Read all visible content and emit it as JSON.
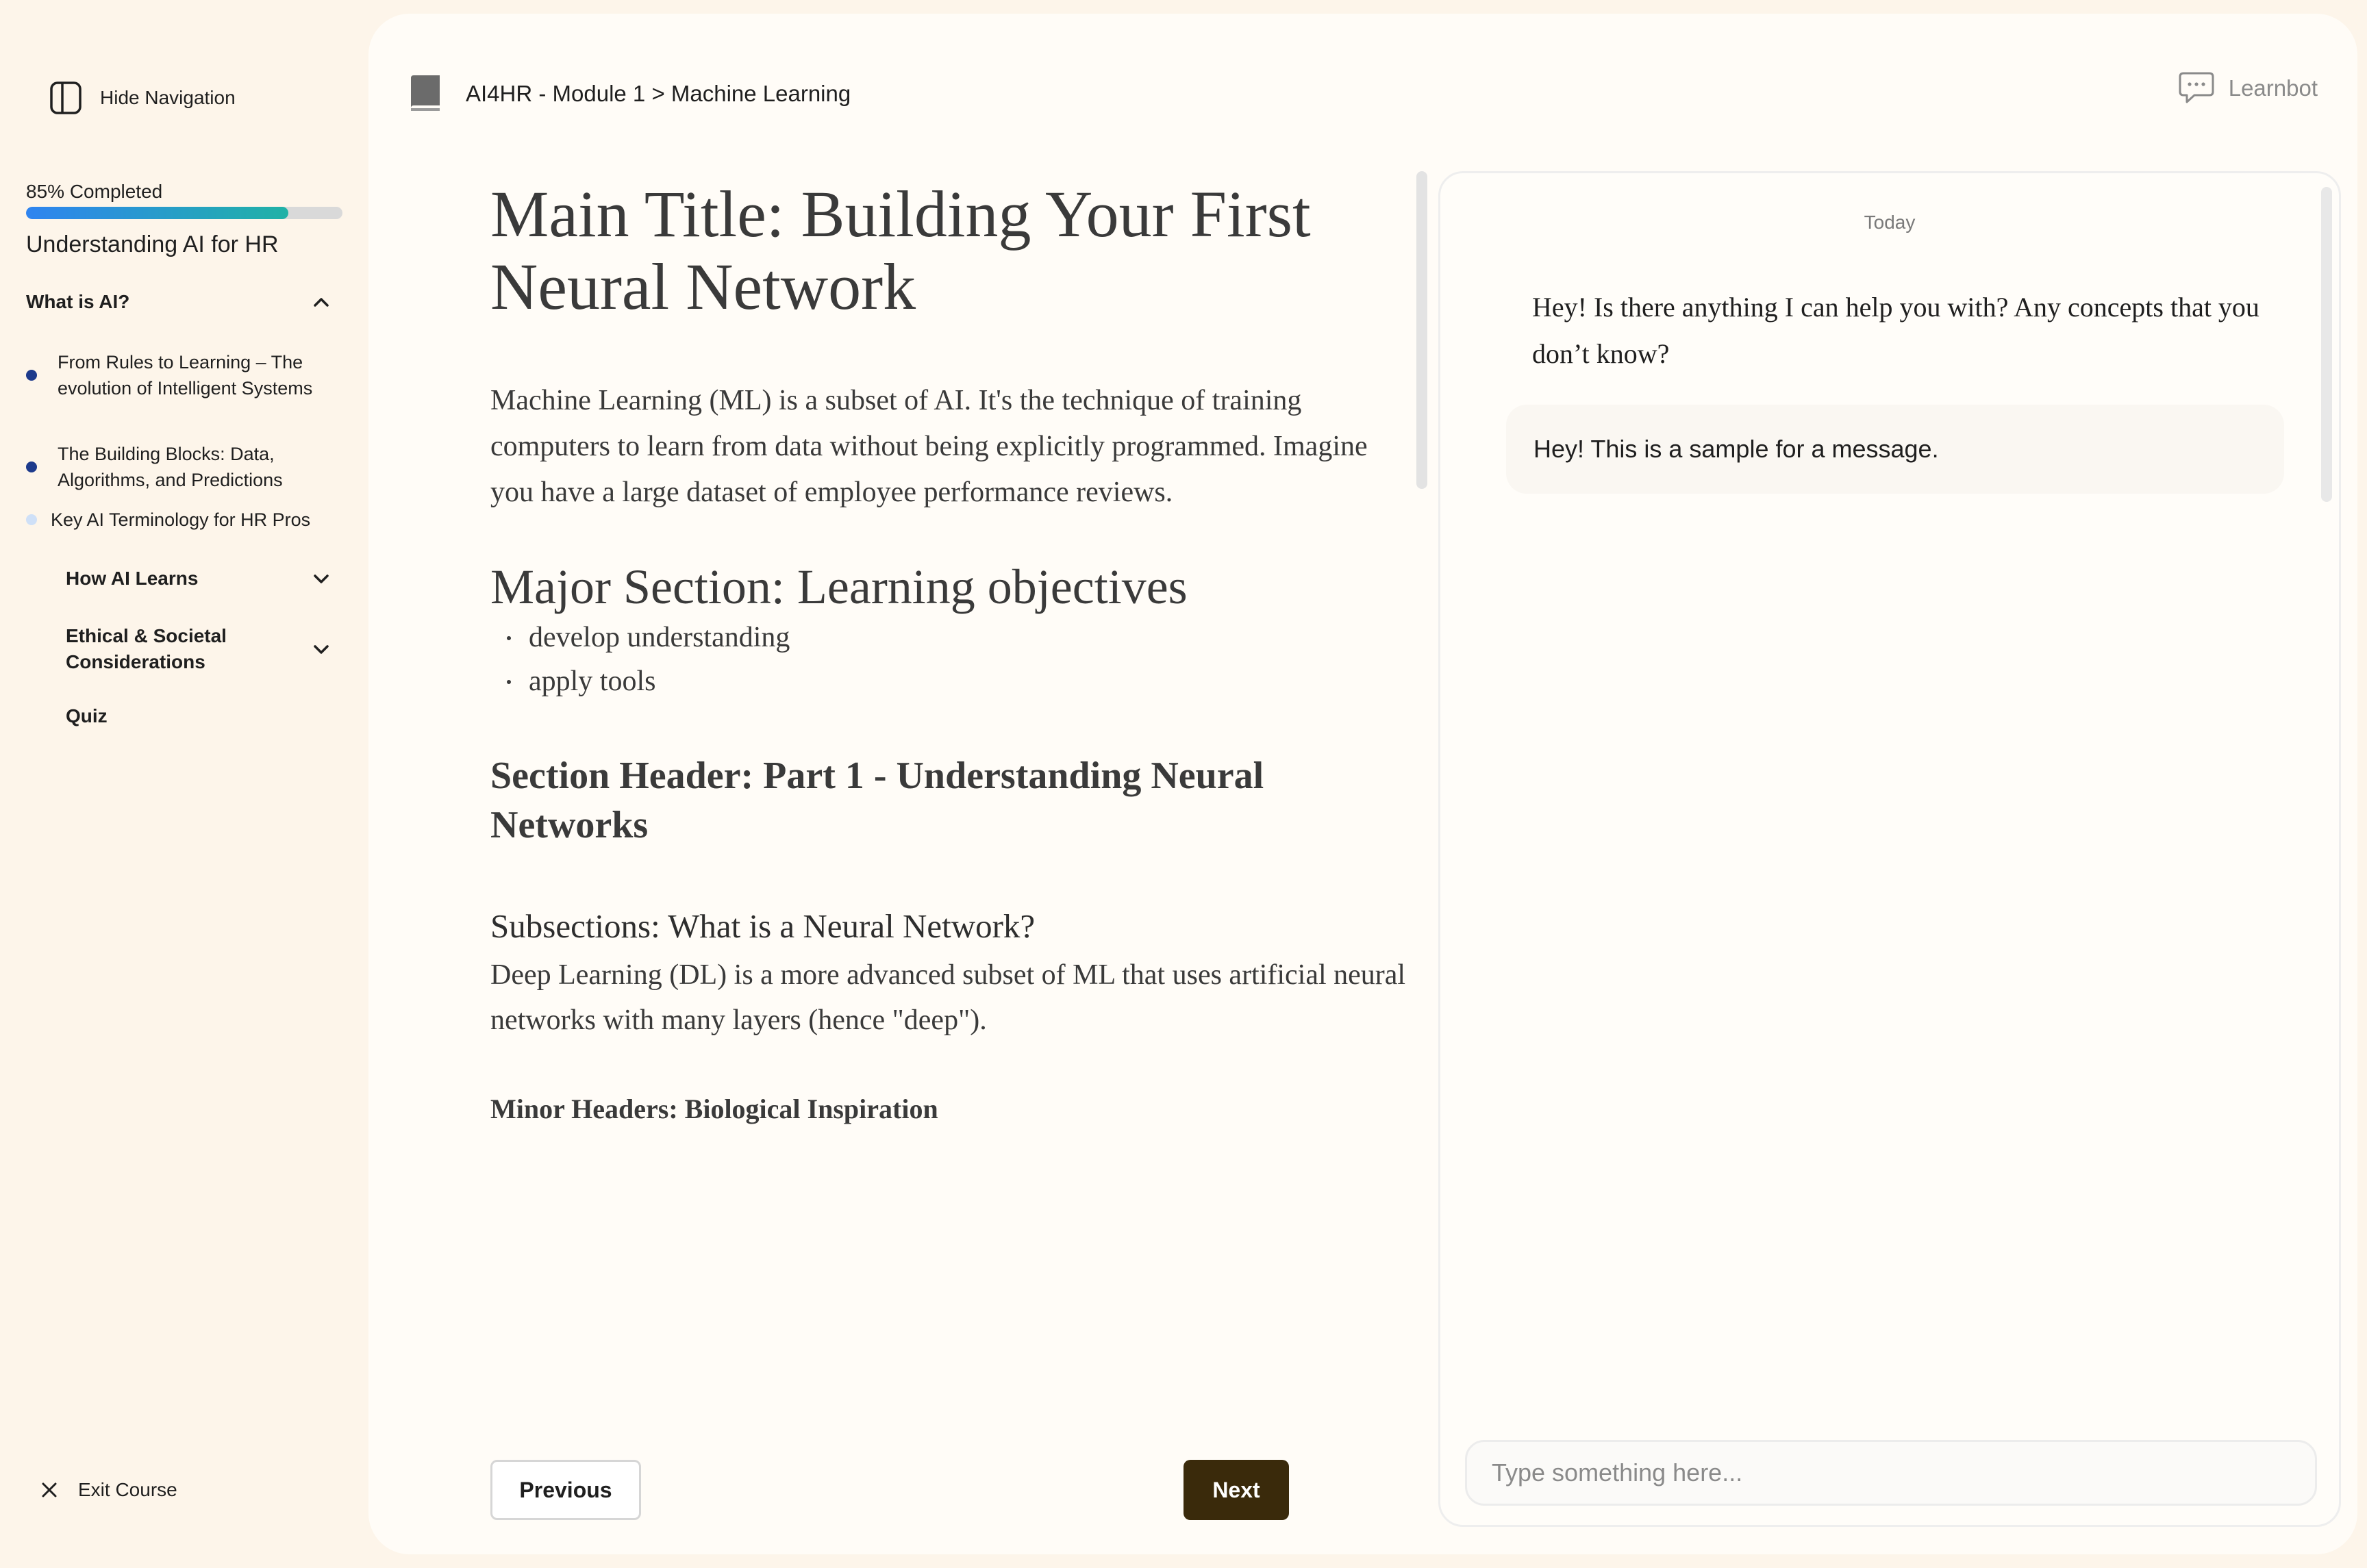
{
  "sidebar": {
    "hide_nav_label": "Hide Navigation",
    "progress_label": "85% Completed",
    "progress_fraction": 0.83,
    "course_title": "Understanding AI for HR",
    "sections": [
      {
        "title": "What is AI?",
        "expanded": true,
        "lessons": [
          {
            "label": "From Rules to Learning – The evolution of Intelligent Systems",
            "status": "done"
          },
          {
            "label": "The Building Blocks: Data, Algorithms, and Predictions",
            "status": "done"
          },
          {
            "label": "Key AI Terminology for HR Pros",
            "status": "todo"
          }
        ]
      },
      {
        "title": "How AI Learns",
        "expanded": false
      },
      {
        "title": "Ethical & Societal Considerations",
        "expanded": false
      },
      {
        "title": "Quiz"
      }
    ],
    "exit_label": "Exit Course"
  },
  "header": {
    "breadcrumb": "AI4HR - Module 1 > Machine Learning",
    "learnbot_label": "Learnbot"
  },
  "content": {
    "main_title": "Main Title: Building Your First Neural Network",
    "intro": "Machine Learning (ML) is a subset of AI. It's the technique of training computers to learn from data without being explicitly programmed. Imagine you have a large dataset of employee performance reviews.",
    "major_section": "Major Section: Learning objectives",
    "objectives": [
      "develop understanding",
      "apply tools"
    ],
    "section_header": "Section Header:  Part 1 - Understanding Neural Networks",
    "subsection": "Subsections: What is a Neural Network?",
    "subsection_body": "Deep Learning (DL) is a more advanced subset of ML that uses artificial neural networks with many layers (hence \"deep\").",
    "minor_header": "Minor Headers: Biological Inspiration"
  },
  "nav_buttons": {
    "previous": "Previous",
    "next": "Next"
  },
  "chat": {
    "date_label": "Today",
    "bot_message": "Hey! Is there anything I can help you with? Any concepts that you don’t know?",
    "user_message": "Hey! This is a sample for a message.",
    "input_placeholder": "Type something here..."
  },
  "colors": {
    "page_bg": "#fdf5ea",
    "panel_bg": "#fffcf7",
    "progress_start": "#2f84f0",
    "progress_end": "#20b2a6",
    "dot_done": "#1d3a8c",
    "dot_todo": "#cfe0f7",
    "next_button": "#3a2a0b"
  },
  "icons": {
    "hide_nav": "sidebar-panel-icon",
    "section_expanded": "chevron-up-icon",
    "section_collapsed": "chevron-down-icon",
    "exit": "close-icon",
    "breadcrumb": "book-icon",
    "learnbot": "chat-bubble-icon"
  }
}
